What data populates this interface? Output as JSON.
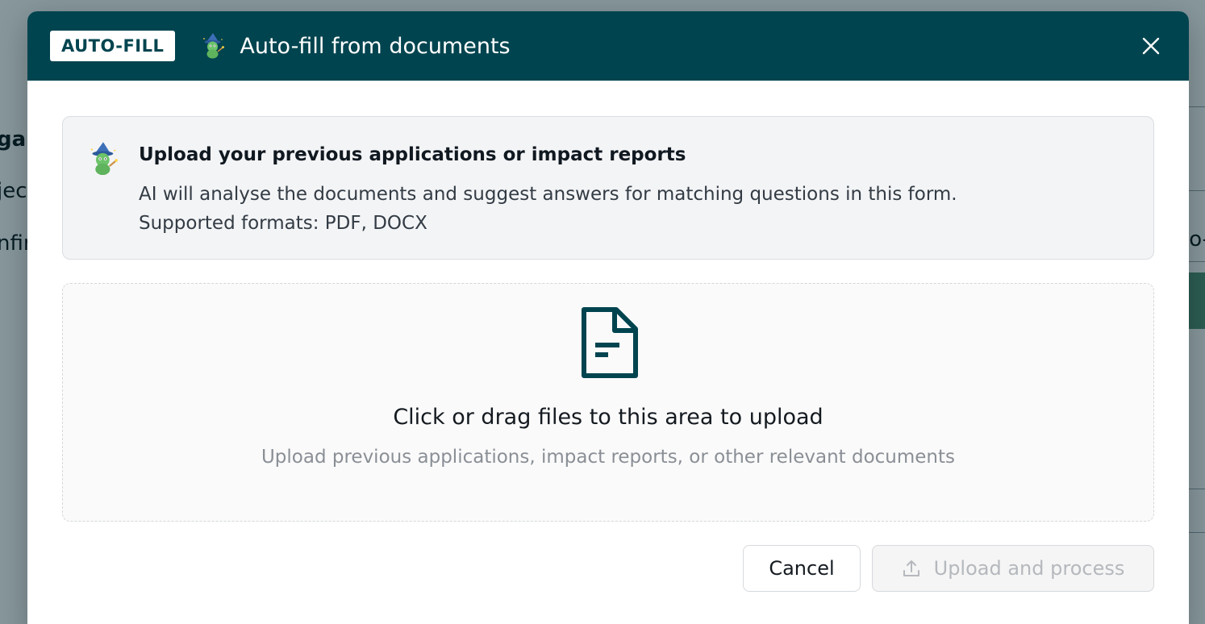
{
  "background": {
    "fragments": [
      "gar",
      "jec",
      "nfir",
      "o-"
    ]
  },
  "modal": {
    "badge": "AUTO-FILL",
    "title": "Auto-fill from documents",
    "close_icon": "close-icon"
  },
  "info": {
    "title": "Upload your previous applications or impact reports",
    "description": "AI will analyse the documents and suggest answers for matching questions in this form.",
    "formats": "Supported formats: PDF, DOCX"
  },
  "dropzone": {
    "title": "Click or drag files to this area to upload",
    "hint": "Upload previous applications, impact reports, or other relevant documents",
    "icon": "file-icon"
  },
  "footer": {
    "cancel_label": "Cancel",
    "upload_label": "Upload and process",
    "upload_icon": "upload-icon"
  },
  "colors": {
    "header_bg": "#00444f",
    "accent": "#00444f",
    "dimmed_text": "#8a8f96"
  }
}
